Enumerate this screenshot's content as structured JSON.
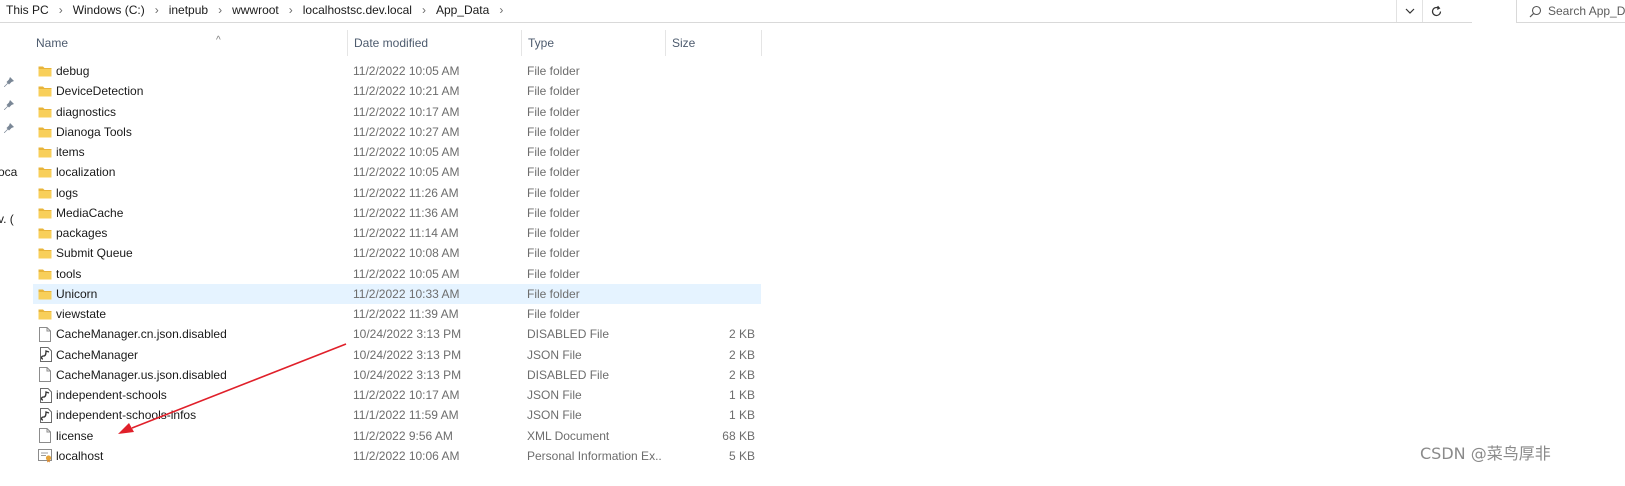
{
  "breadcrumb": [
    "This PC",
    "Windows (C:)",
    "inetpub",
    "wwwroot",
    "localhostsc.dev.local",
    "App_Data"
  ],
  "search": {
    "placeholder": "Search App_D"
  },
  "nav": {
    "fragments": [
      "oca",
      "v. ("
    ]
  },
  "columns": {
    "name": "Name",
    "date": "Date modified",
    "type": "Type",
    "size": "Size"
  },
  "files": [
    {
      "name": "debug",
      "date": "11/2/2022 10:05 AM",
      "type": "File folder",
      "size": "",
      "icon": "folder-icon"
    },
    {
      "name": "DeviceDetection",
      "date": "11/2/2022 10:21 AM",
      "type": "File folder",
      "size": "",
      "icon": "folder-icon"
    },
    {
      "name": "diagnostics",
      "date": "11/2/2022 10:17 AM",
      "type": "File folder",
      "size": "",
      "icon": "folder-icon"
    },
    {
      "name": "Dianoga Tools",
      "date": "11/2/2022 10:27 AM",
      "type": "File folder",
      "size": "",
      "icon": "folder-icon"
    },
    {
      "name": "items",
      "date": "11/2/2022 10:05 AM",
      "type": "File folder",
      "size": "",
      "icon": "folder-icon"
    },
    {
      "name": "localization",
      "date": "11/2/2022 10:05 AM",
      "type": "File folder",
      "size": "",
      "icon": "folder-icon"
    },
    {
      "name": "logs",
      "date": "11/2/2022 11:26 AM",
      "type": "File folder",
      "size": "",
      "icon": "folder-icon"
    },
    {
      "name": "MediaCache",
      "date": "11/2/2022 11:36 AM",
      "type": "File folder",
      "size": "",
      "icon": "folder-icon"
    },
    {
      "name": "packages",
      "date": "11/2/2022 11:14 AM",
      "type": "File folder",
      "size": "",
      "icon": "folder-icon"
    },
    {
      "name": "Submit Queue",
      "date": "11/2/2022 10:08 AM",
      "type": "File folder",
      "size": "",
      "icon": "folder-icon"
    },
    {
      "name": "tools",
      "date": "11/2/2022 10:05 AM",
      "type": "File folder",
      "size": "",
      "icon": "folder-icon"
    },
    {
      "name": "Unicorn",
      "date": "11/2/2022 10:33 AM",
      "type": "File folder",
      "size": "",
      "icon": "folder-icon",
      "selected": true
    },
    {
      "name": "viewstate",
      "date": "11/2/2022 11:39 AM",
      "type": "File folder",
      "size": "",
      "icon": "folder-icon"
    },
    {
      "name": "CacheManager.cn.json.disabled",
      "date": "10/24/2022 3:13 PM",
      "type": "DISABLED File",
      "size": "2 KB",
      "icon": "file-icon"
    },
    {
      "name": "CacheManager",
      "date": "10/24/2022 3:13 PM",
      "type": "JSON File",
      "size": "2 KB",
      "icon": "json-file-icon"
    },
    {
      "name": "CacheManager.us.json.disabled",
      "date": "10/24/2022 3:13 PM",
      "type": "DISABLED File",
      "size": "2 KB",
      "icon": "file-icon"
    },
    {
      "name": "independent-schools",
      "date": "11/2/2022 10:17 AM",
      "type": "JSON File",
      "size": "1 KB",
      "icon": "json-file-icon"
    },
    {
      "name": "independent-schools-infos",
      "date": "11/1/2022 11:59 AM",
      "type": "JSON File",
      "size": "1 KB",
      "icon": "json-file-icon"
    },
    {
      "name": "license",
      "date": "11/2/2022 9:56 AM",
      "type": "XML Document",
      "size": "68 KB",
      "icon": "file-icon"
    },
    {
      "name": "localhost",
      "date": "11/2/2022 10:06 AM",
      "type": "Personal Information Ex...",
      "size": "5 KB",
      "icon": "certificate-icon"
    }
  ],
  "watermark": "CSDN @菜鸟厚非",
  "colors": {
    "folder": "#f4c04a",
    "selected": "#e5f3ff",
    "annotation_arrow": "#e0202a"
  }
}
